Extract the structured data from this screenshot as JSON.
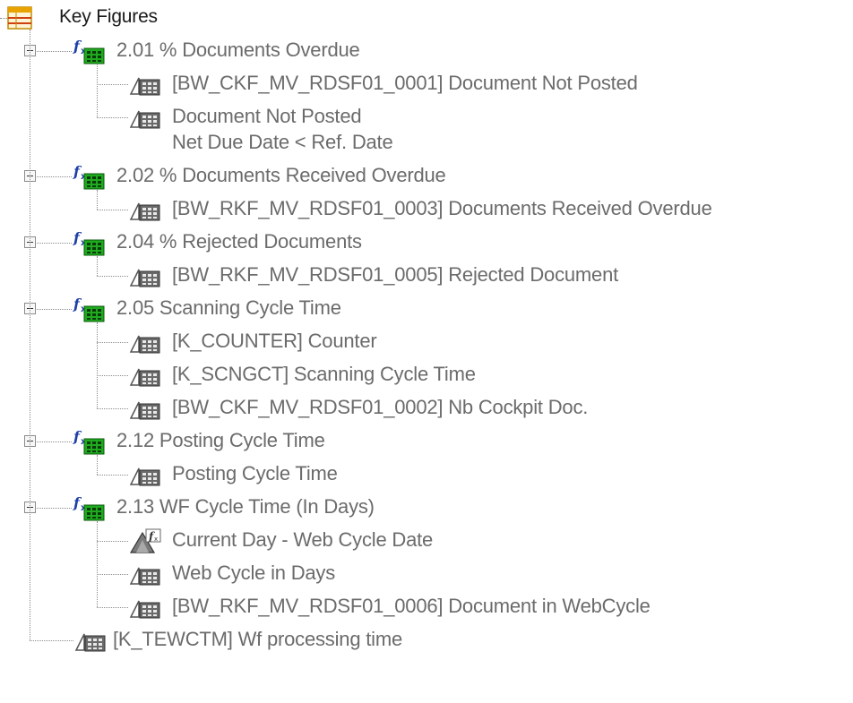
{
  "tree": {
    "root": {
      "label": "Key Figures",
      "icon": "table-icon"
    },
    "groups": [
      {
        "label": "2.01 % Documents Overdue",
        "icon": "formula-icon",
        "children": [
          {
            "label": "[BW_CKF_MV_RDSF01_0001] Document Not Posted",
            "icon": "key-figure-icon"
          },
          {
            "label": "Document Not Posted",
            "label_line2": "Net Due Date < Ref. Date",
            "icon": "key-figure-icon"
          }
        ]
      },
      {
        "label": "2.02 % Documents Received Overdue",
        "icon": "formula-icon",
        "children": [
          {
            "label": "[BW_RKF_MV_RDSF01_0003] Documents Received Overdue",
            "icon": "key-figure-icon"
          }
        ]
      },
      {
        "label": "2.04 % Rejected Documents",
        "icon": "formula-icon",
        "children": [
          {
            "label": "[BW_RKF_MV_RDSF01_0005] Rejected Document",
            "icon": "key-figure-icon"
          }
        ]
      },
      {
        "label": "2.05 Scanning Cycle Time",
        "icon": "formula-icon",
        "children": [
          {
            "label": "[K_COUNTER] Counter",
            "icon": "key-figure-icon"
          },
          {
            "label": "[K_SCNGCT] Scanning Cycle Time",
            "icon": "key-figure-icon"
          },
          {
            "label": "[BW_CKF_MV_RDSF01_0002] Nb Cockpit Doc.",
            "icon": "key-figure-icon"
          }
        ]
      },
      {
        "label": "2.12 Posting Cycle Time",
        "icon": "formula-icon",
        "children": [
          {
            "label": "Posting Cycle Time",
            "icon": "key-figure-icon"
          }
        ]
      },
      {
        "label": "2.13 WF Cycle Time (In Days)",
        "icon": "formula-icon",
        "children": [
          {
            "label": "Current Day - Web Cycle Date",
            "icon": "formula-variable-icon"
          },
          {
            "label": "Web Cycle in Days",
            "icon": "key-figure-icon"
          },
          {
            "label": "[BW_RKF_MV_RDSF01_0006] Document in WebCycle",
            "icon": "key-figure-icon"
          }
        ]
      }
    ],
    "trailing": {
      "label": "[K_TEWCTM] Wf processing time",
      "icon": "key-figure-icon"
    }
  }
}
